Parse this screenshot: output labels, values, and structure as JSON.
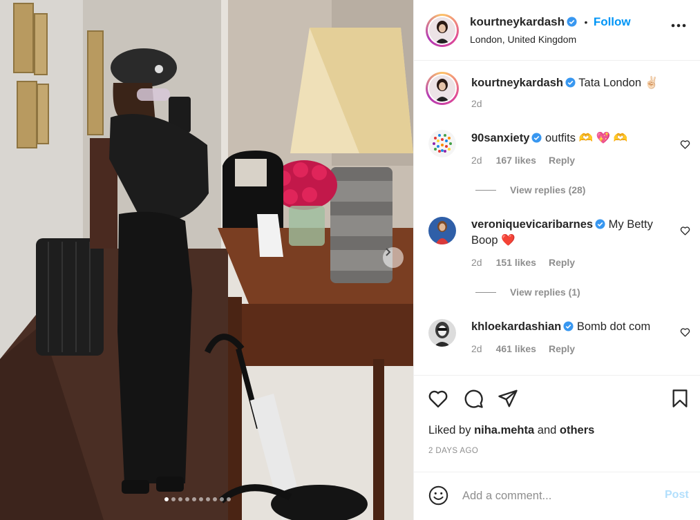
{
  "post": {
    "photo_alt": "",
    "slide_count": 10,
    "active_slide": 1
  },
  "header": {
    "username": "kourtneykardash",
    "separator": "•",
    "follow_label": "Follow",
    "location": "London, United Kingdom",
    "more_icon": "more-horizontal-icon"
  },
  "caption": {
    "username": "kourtneykardash",
    "text": "Tata London ✌🏻",
    "time": "2d"
  },
  "comments": [
    {
      "username": "90sanxiety",
      "text": "outfits 🫶 💖 🫶",
      "time": "2d",
      "likes": "167 likes",
      "reply": "Reply",
      "view_replies": "View replies (28)"
    },
    {
      "username": "veroniquevicaribarnes",
      "text": "My Betty Boop ❤️",
      "time": "2d",
      "likes": "151 likes",
      "reply": "Reply",
      "view_replies": "View replies (1)"
    },
    {
      "username": "khloekardashian",
      "text": "Bomb dot com",
      "time": "2d",
      "likes": "461 likes",
      "reply": "Reply"
    }
  ],
  "actions": {
    "liked_by_prefix": "Liked by",
    "liked_by_user": "niha.mehta",
    "liked_by_and": "and",
    "liked_by_others": "others",
    "time_ago": "2 DAYS AGO"
  },
  "comment_box": {
    "placeholder": "Add a comment...",
    "post_label": "Post"
  },
  "colors": {
    "accent": "#0095f6",
    "post_disabled": "#b2dffc",
    "muted": "#8e8e8e"
  }
}
